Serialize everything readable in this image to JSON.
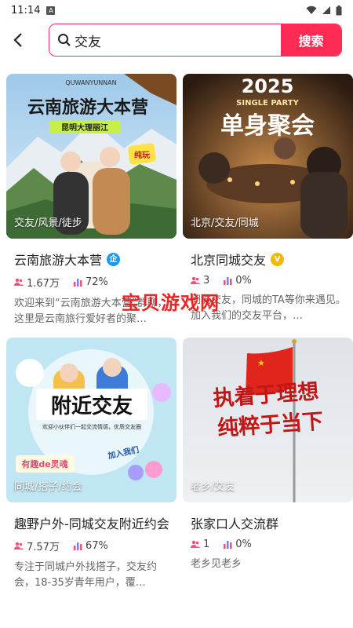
{
  "status_bar": {
    "time": "11:14",
    "a_icon": "A"
  },
  "search": {
    "query": "交友",
    "button_label": "搜索"
  },
  "watermark": "宝贝游戏网",
  "cards": [
    {
      "image_tag": "交友/风景/徒步",
      "title": "云南旅游大本营",
      "badge": "企",
      "badge_color": "#1a9af5",
      "members": "1.67万",
      "activity": "72%",
      "desc": "欢迎来到“云南旅游大本营”群聊，这里是云南旅行爱好者的聚…",
      "poster": {
        "top_text": "QUWANYUNNAN",
        "headline": "云南旅游大本营",
        "sub": "昆明大理丽江",
        "sticker": "纯玩"
      }
    },
    {
      "image_tag": "北京/交友/同城",
      "title": "北京同城交友",
      "badge": "V",
      "badge_color": "#f5b800",
      "members": "3",
      "activity": "0%",
      "desc": "同城交友，同城的TA等你来遇见。加入我们的交友平台，…",
      "poster": {
        "year": "2025",
        "sub": "SINGLE PARTY",
        "headline": "单身聚会"
      }
    },
    {
      "image_tag": "同城/搭子/约会",
      "title": "趣野户外-同城交友附近约会",
      "members": "7.57万",
      "activity": "67%",
      "desc": "专注于同城户外找搭子，交友约会，18-35岁青年用户，覆…",
      "poster": {
        "headline": "附近交友",
        "sub": "欢迎小伙伴们一起交流情感，优质交友圈",
        "fun": "有趣de灵魂",
        "join": "加入我们"
      }
    },
    {
      "image_tag": "老乡/交友",
      "title": "张家口人交流群",
      "members": "1",
      "activity": "0%",
      "desc": "老乡见老乡",
      "poster": {
        "line1": "执着于理想",
        "line2": "纯粹于当下"
      }
    }
  ]
}
